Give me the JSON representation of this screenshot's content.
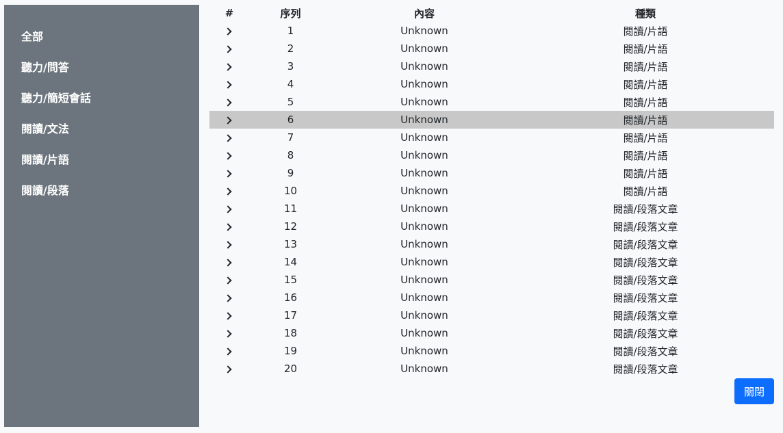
{
  "sidebar": {
    "items": [
      {
        "label": "全部"
      },
      {
        "label": "聽力/問答"
      },
      {
        "label": "聽力/簡短會話"
      },
      {
        "label": "閱讀/文法"
      },
      {
        "label": "閱讀/片語"
      },
      {
        "label": "閱讀/段落"
      }
    ]
  },
  "table": {
    "headers": {
      "hash": "#",
      "index": "序列",
      "content": "內容",
      "type": "種類"
    },
    "selected_row": 6,
    "rows": [
      {
        "index": "1",
        "content": "Unknown",
        "type": "閱讀/片語"
      },
      {
        "index": "2",
        "content": "Unknown",
        "type": "閱讀/片語"
      },
      {
        "index": "3",
        "content": "Unknown",
        "type": "閱讀/片語"
      },
      {
        "index": "4",
        "content": "Unknown",
        "type": "閱讀/片語"
      },
      {
        "index": "5",
        "content": "Unknown",
        "type": "閱讀/片語"
      },
      {
        "index": "6",
        "content": "Unknown",
        "type": "閱讀/片語"
      },
      {
        "index": "7",
        "content": "Unknown",
        "type": "閱讀/片語"
      },
      {
        "index": "8",
        "content": "Unknown",
        "type": "閱讀/片語"
      },
      {
        "index": "9",
        "content": "Unknown",
        "type": "閱讀/片語"
      },
      {
        "index": "10",
        "content": "Unknown",
        "type": "閱讀/片語"
      },
      {
        "index": "11",
        "content": "Unknown",
        "type": "閱讀/段落文章"
      },
      {
        "index": "12",
        "content": "Unknown",
        "type": "閱讀/段落文章"
      },
      {
        "index": "13",
        "content": "Unknown",
        "type": "閱讀/段落文章"
      },
      {
        "index": "14",
        "content": "Unknown",
        "type": "閱讀/段落文章"
      },
      {
        "index": "15",
        "content": "Unknown",
        "type": "閱讀/段落文章"
      },
      {
        "index": "16",
        "content": "Unknown",
        "type": "閱讀/段落文章"
      },
      {
        "index": "17",
        "content": "Unknown",
        "type": "閱讀/段落文章"
      },
      {
        "index": "18",
        "content": "Unknown",
        "type": "閱讀/段落文章"
      },
      {
        "index": "19",
        "content": "Unknown",
        "type": "閱讀/段落文章"
      },
      {
        "index": "20",
        "content": "Unknown",
        "type": "閱讀/段落文章"
      }
    ]
  },
  "close_button": {
    "label": "關閉",
    "color": "#0d6efd"
  },
  "colors": {
    "sidebar_bg": "#6c757d",
    "page_bg": "#f8f9fa",
    "selected_row_bg": "#c8c8c8"
  },
  "icons": {
    "row_expand": "chevron-right-icon"
  }
}
